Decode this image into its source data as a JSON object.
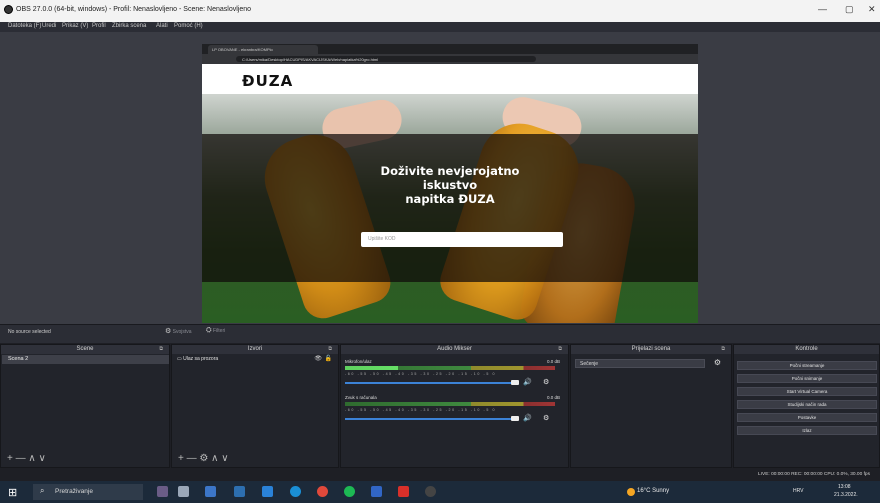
{
  "window": {
    "title": "OBS 27.0.0 (64-bit, windows) - Profil: Nenaslovljeno - Scene: Nenaslovljeno",
    "controls": [
      "—",
      "▢",
      "✕"
    ]
  },
  "menu": [
    "Datoteka (F)",
    "Uredi",
    "Prikaz (V)",
    "Profil",
    "Zbirka scena",
    "Alati",
    "Pomoć (H)"
  ],
  "browser": {
    "tab_title": "LP OBOVANE - ekranbra/KOMPlo",
    "url": "C:/Users/mika/Desktop/HACUDPIS/AKVACIJSKA/Web/napiatka%20gro.html"
  },
  "site": {
    "logo": "ĐUZA",
    "hero_line1": "Doživite nevjerojatno",
    "hero_line2": "iskustvo",
    "hero_line3": "napitka ĐUZA",
    "email_placeholder": "Upišite KOD"
  },
  "source_toolbar": {
    "no_source": "No source selected",
    "properties": "Svojstva",
    "filters": "Filteri"
  },
  "docks": {
    "scenes": {
      "title": "Scene",
      "items": [
        "Scena 2"
      ],
      "footer": "+ — ∧ ∨"
    },
    "sources": {
      "title": "Izvori",
      "items": [
        "Ulaz sa prozora"
      ],
      "footer": "+ — ⚙ ∧ ∨"
    },
    "mixer": {
      "title": "Audio Mikser",
      "channels": [
        {
          "name": "Mikrofon/ulaz",
          "db": "0.0 dB",
          "level": 0.25
        },
        {
          "name": "Zvuk s računala",
          "db": "0.0 dB",
          "level": 0.0
        }
      ],
      "ticks": "-60 -55 -50 -45 -40 -35 -30 -25 -20 -15 -10 -5 0"
    },
    "transitions": {
      "title": "Prijelazi scena",
      "selected": "Sečenje"
    },
    "controls": {
      "title": "Kontrole",
      "buttons": [
        "Počni streamanje",
        "Počni snimanje",
        "Start Virtual Camera",
        "Studijski način rada",
        "Postavke",
        "Izlaz"
      ]
    }
  },
  "status": "LIVE: 00:00:00   REC: 00:00:00   CPU: 0.0%, 30.00 fps",
  "taskbar": {
    "search": "Pretraživanje",
    "weather": "16°C Sunny",
    "lang": "HRV",
    "time": "13:08",
    "date": "21.3.2022."
  },
  "colors": {
    "accent_blue": "#3c82d6",
    "meter_green": "#5fd15f",
    "brand_bottle": "#e49c1c"
  }
}
